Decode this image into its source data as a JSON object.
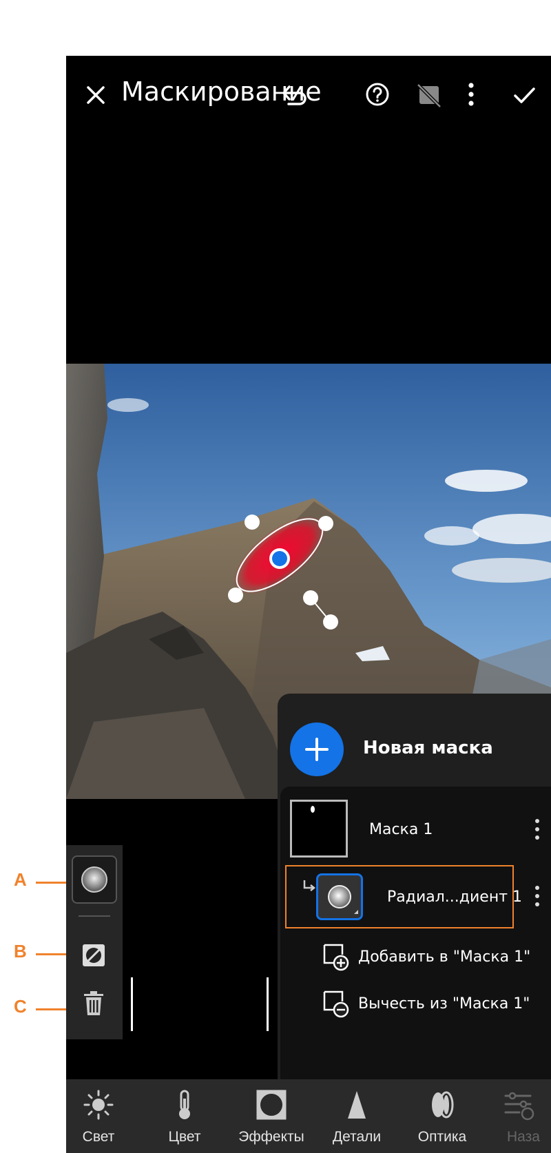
{
  "topbar": {
    "title": "Маскирование",
    "icons": [
      "close-icon",
      "undo-icon",
      "help-icon",
      "mask-overlay-toggle-icon",
      "more-vertical-icon",
      "checkmark-icon"
    ]
  },
  "masks_panel": {
    "new_mask_label": "Новая маска",
    "mask_name": "Маска 1",
    "component_name": "Радиал...диент 1",
    "add_label": "Добавить в \"Маска 1\"",
    "subtract_label": "Вычесть из \"Маска 1\""
  },
  "bottom_toolbar": {
    "items": [
      {
        "label": "Свет",
        "icon": "sun-icon",
        "enabled": true
      },
      {
        "label": "Цвет",
        "icon": "thermometer-icon",
        "enabled": true
      },
      {
        "label": "Эффекты",
        "icon": "vignette-icon",
        "enabled": true
      },
      {
        "label": "Детали",
        "icon": "triangle-icon",
        "enabled": true
      },
      {
        "label": "Оптика",
        "icon": "lens-icon",
        "enabled": true
      },
      {
        "label": "Наза",
        "icon": "sliders-back-icon",
        "enabled": false
      }
    ]
  },
  "annotations": {
    "a": "A",
    "b": "B",
    "c": "C"
  },
  "colors": {
    "accent_blue": "#1473e6",
    "annotation_orange": "#f0822c",
    "mask_overlay_red": "#e0102a"
  }
}
